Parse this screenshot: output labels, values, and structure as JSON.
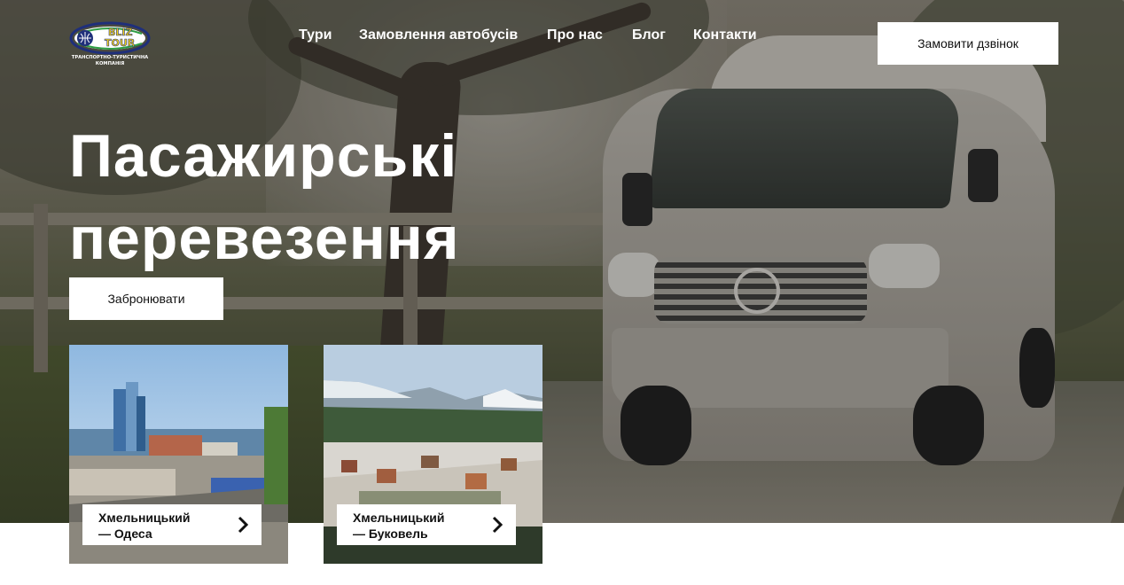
{
  "brand": {
    "logo_word_1": "BLIZ",
    "logo_word_2": "TOUR",
    "tagline_1": "ТРАНСПОРТНО-ТУРИСТИЧНА",
    "tagline_2": "КОМПАНІЯ",
    "colors": {
      "navy": "#1f2f7a",
      "yellow": "#f3d21a",
      "green": "#2f9e44"
    }
  },
  "nav": {
    "items": [
      {
        "label": "Тури"
      },
      {
        "label": "Замовлення автобусів"
      },
      {
        "label": "Про нас"
      },
      {
        "label": "Блог"
      },
      {
        "label": "Контакти"
      }
    ],
    "call_button": "Замовити дзвінок"
  },
  "hero": {
    "title_line_1": "Пасажирські",
    "title_line_2": "перевезення",
    "book_button": "Забронювати"
  },
  "cards": [
    {
      "line_1": "Хмельницький",
      "line_2": "— Одеса",
      "icon": "chevron-right-icon"
    },
    {
      "line_1": "Хмельницький",
      "line_2": "— Буковель",
      "icon": "chevron-right-icon"
    }
  ]
}
